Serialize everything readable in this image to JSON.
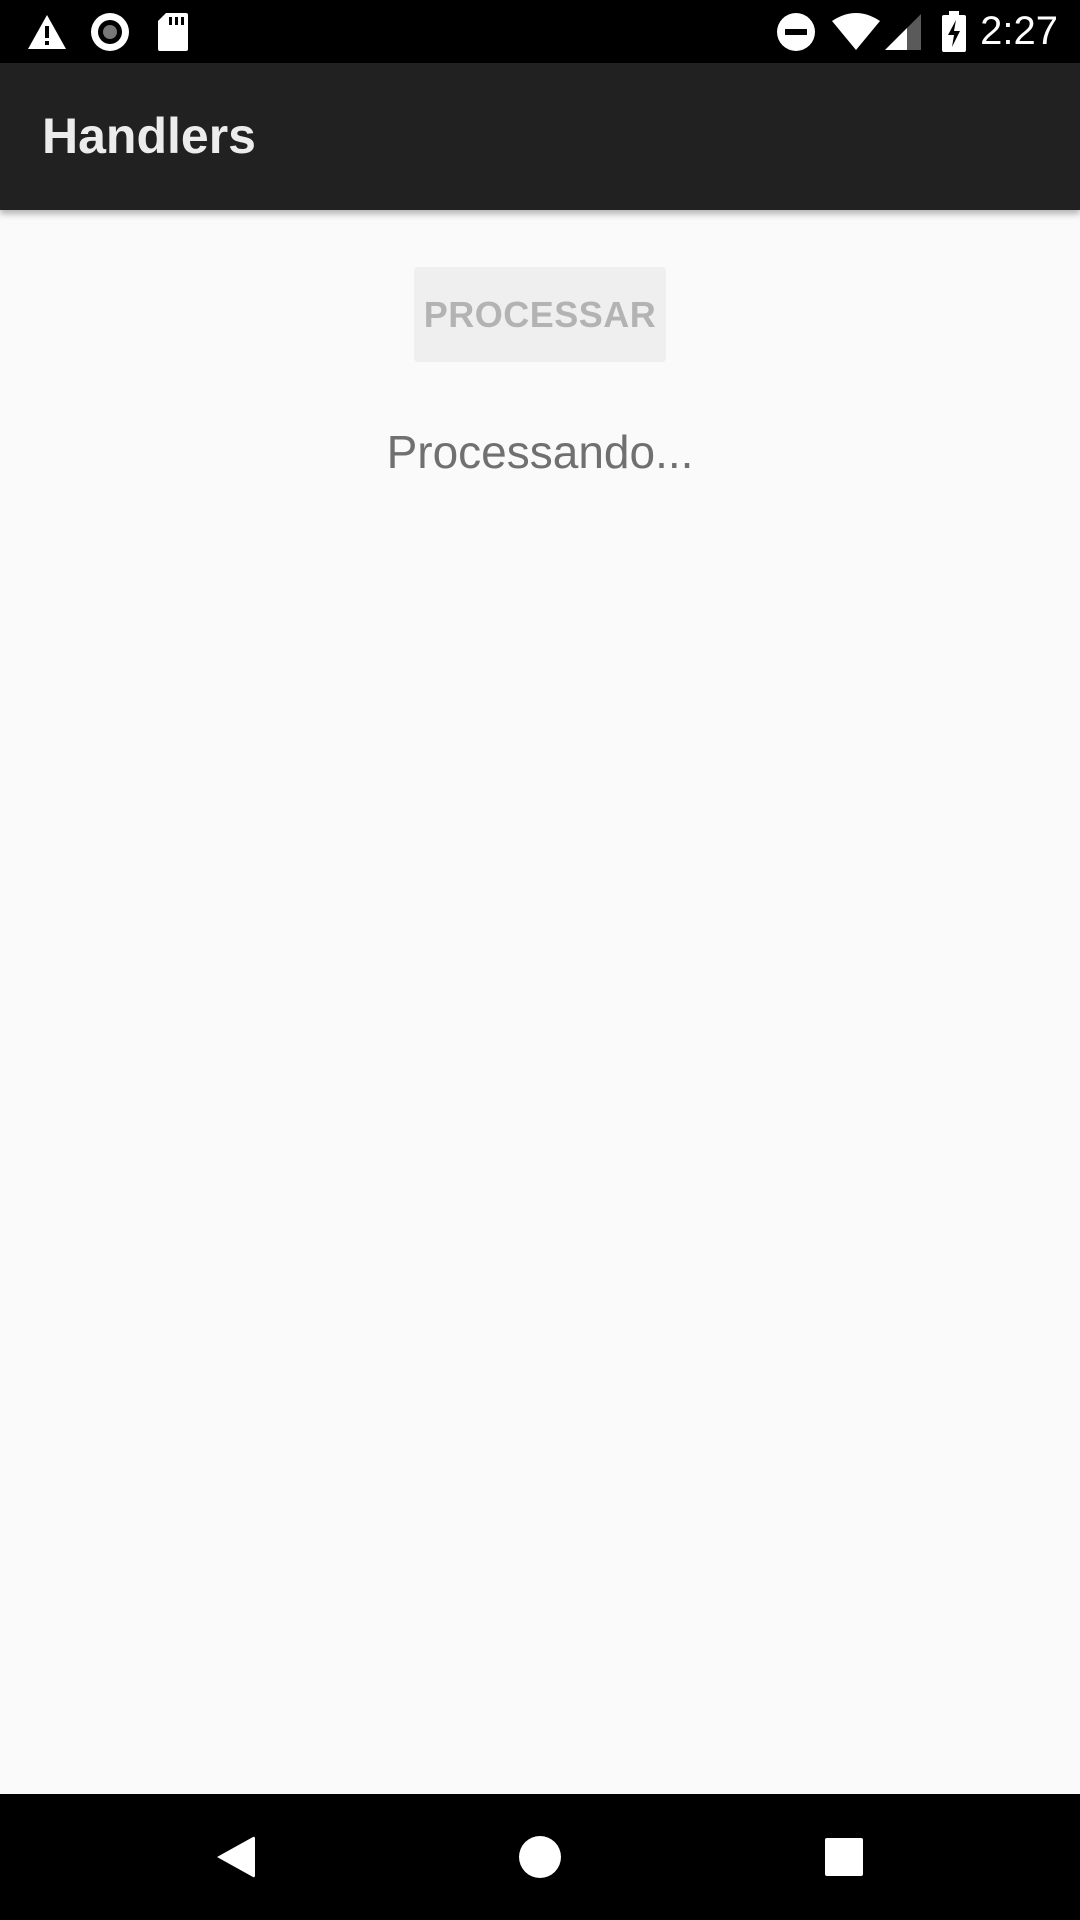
{
  "status_bar": {
    "time": "2:27",
    "left_icons": [
      "warning-icon",
      "record-icon",
      "sd-card-icon"
    ],
    "right_icons": [
      "do-not-disturb-icon",
      "wifi-icon",
      "cell-signal-icon",
      "battery-charging-icon"
    ]
  },
  "app_bar": {
    "title": "Handlers",
    "background": "#212121"
  },
  "main": {
    "process_button_label": "PROCESSAR",
    "status_text": "Processando..."
  },
  "nav_bar": {
    "buttons": [
      "back-icon",
      "home-icon",
      "recents-icon"
    ]
  }
}
